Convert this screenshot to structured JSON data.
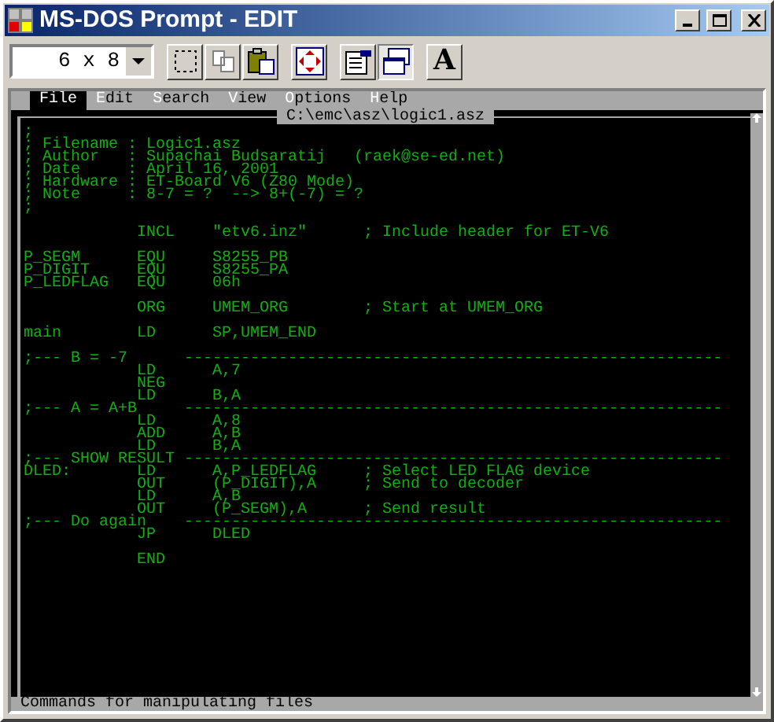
{
  "window": {
    "title": "MS-DOS Prompt - EDIT"
  },
  "toolbar": {
    "font_size": "6 x 8",
    "buttons": [
      {
        "kind": "mark",
        "selected": false
      },
      {
        "kind": "copy",
        "selected": false
      },
      {
        "kind": "paste",
        "selected": false
      },
      {
        "kind": "fullscreen",
        "selected": false
      },
      {
        "kind": "properties",
        "selected": false
      },
      {
        "kind": "background",
        "selected": true
      },
      {
        "kind": "font",
        "label": "A",
        "selected": false
      }
    ]
  },
  "menu": [
    {
      "label": "File",
      "selected": true
    },
    {
      "label": "Edit",
      "selected": false
    },
    {
      "label": "Search",
      "selected": false
    },
    {
      "label": "View",
      "selected": false
    },
    {
      "label": "Options",
      "selected": false
    },
    {
      "label": "Help",
      "selected": false
    }
  ],
  "file_path": "C:\\emc\\asz\\logic1.asz",
  "lines": [
    {
      "kind": "code",
      "text": ";"
    },
    {
      "kind": "code",
      "text": "; Filename : Logic1.asz"
    },
    {
      "kind": "code",
      "text": "; Author   : Supachai Budsaratij   (raek@se-ed.net)"
    },
    {
      "kind": "code",
      "text": "; Date     : April 16, 2001"
    },
    {
      "kind": "code",
      "text": "; Hardware : ET-Board V6 (Z80 Mode)"
    },
    {
      "kind": "code",
      "text": "; Note     : 8-7 = ?  --> 8+(-7) = ?"
    },
    {
      "kind": "code",
      "text": ";"
    },
    {
      "kind": "blank"
    },
    {
      "kind": "code",
      "text": "            INCL    \"etv6.inz\"      ; Include header for ET-V6"
    },
    {
      "kind": "blank"
    },
    {
      "kind": "code",
      "text": "P_SEGM      EQU     S8255_PB"
    },
    {
      "kind": "code",
      "text": "P_DIGIT     EQU     S8255_PA"
    },
    {
      "kind": "code",
      "text": "P_LEDFLAG   EQU     06h"
    },
    {
      "kind": "blank"
    },
    {
      "kind": "code",
      "text": "            ORG     UMEM_ORG        ; Start at UMEM_ORG"
    },
    {
      "kind": "blank"
    },
    {
      "kind": "code",
      "text": "main        LD      SP,UMEM_END"
    },
    {
      "kind": "blank"
    },
    {
      "kind": "code",
      "text": ";--- B = -7      ---------------------------------------------------------"
    },
    {
      "kind": "code",
      "text": "            LD      A,7"
    },
    {
      "kind": "code",
      "text": "            NEG"
    },
    {
      "kind": "code",
      "text": "            LD      B,A"
    },
    {
      "kind": "code",
      "text": ";--- A = A+B     ---------------------------------------------------------"
    },
    {
      "kind": "code",
      "text": "            LD      A,8"
    },
    {
      "kind": "code",
      "text": "            ADD     A,B"
    },
    {
      "kind": "code",
      "text": "            LD      B,A"
    },
    {
      "kind": "code",
      "text": ";--- SHOW RESULT ---------------------------------------------------------"
    },
    {
      "kind": "code",
      "text": "DLED:       LD      A,P_LEDFLAG     ; Select LED FLAG device"
    },
    {
      "kind": "code",
      "text": "            OUT     (P_DIGIT),A     ; Send to decoder"
    },
    {
      "kind": "code",
      "text": "            LD      A,B"
    },
    {
      "kind": "code",
      "text": "            OUT     (P_SEGM),A      ; Send result"
    },
    {
      "kind": "code",
      "text": ";--- Do again    ---------------------------------------------------------"
    },
    {
      "kind": "code",
      "text": "            JP      DLED"
    },
    {
      "kind": "blank"
    },
    {
      "kind": "code",
      "text": "            END"
    }
  ],
  "status_bar": "Commands for manipulating files"
}
